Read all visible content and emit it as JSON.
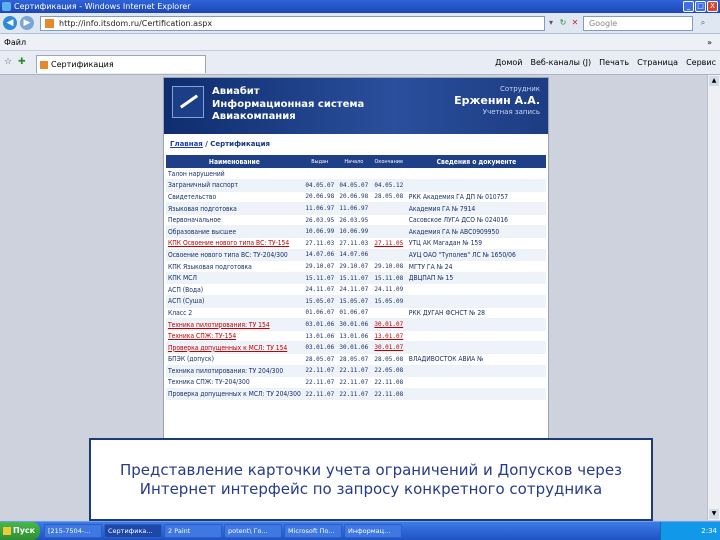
{
  "window": {
    "title": "Сертификация - Windows Internet Explorer",
    "buttons": [
      "_",
      "□",
      "X"
    ]
  },
  "address": {
    "url": "http://info.itsdom.ru/Certification.aspx",
    "search_placeholder": "Google"
  },
  "menu": {
    "file": "Файл",
    "help_glyph": "»"
  },
  "tab": {
    "title": "Сертификация"
  },
  "toolbar": {
    "home": "Домой",
    "feeds": "Веб-каналы (J)",
    "print": "Печать",
    "page": "Страница",
    "tools": "Сервис"
  },
  "site": {
    "brand_line1": "Авиабит",
    "brand_line2": "Информационная система",
    "brand_line3": "Авиакомпания",
    "user_role": "Сотрудник",
    "user_name": "Ерженин А.А.",
    "user_account": "Учетная запись"
  },
  "breadcrumb": {
    "home": "Главная",
    "separator": " / ",
    "current": "Сертификация"
  },
  "table": {
    "headers": [
      "Наименование",
      "Выдан",
      "Начало",
      "Окончание",
      "Сведения о документе"
    ],
    "rows": [
      {
        "name": "Талон нарушений",
        "issued": "",
        "start": "",
        "end": "",
        "info": ""
      },
      {
        "name": "Заграничный паспорт",
        "issued": "04.05.07",
        "start": "04.05.07",
        "end": "04.05.12",
        "info": ""
      },
      {
        "name": "Свидетельство",
        "issued": "20.06.98",
        "start": "20.06.98",
        "end": "28.05.08",
        "info": "РКК Академия ГА ДП № 010757"
      },
      {
        "name": "Языковая подготовка",
        "issued": "11.06.97",
        "start": "11.06.97",
        "end": "",
        "info": "Академия ГА № 7914"
      },
      {
        "name": "Первоначальное",
        "issued": "26.03.95",
        "start": "26.03.95",
        "end": "",
        "info": "Сасовское ЛУГА ДСО № 024016"
      },
      {
        "name": "Образование высшее",
        "issued": "10.06.99",
        "start": "10.06.99",
        "end": "",
        "info": "Академия ГА № АВС0909950"
      },
      {
        "name": "КПК Освоение нового типа ВС: ТУ-154",
        "issued": "27.11.03",
        "start": "27.11.03",
        "end": "27.11.05",
        "info": "УТЦ АК Магадан № 159",
        "warn": true
      },
      {
        "name": "Освоение нового типа ВС: ТУ-204/300",
        "issued": "14.07.06",
        "start": "14.07.06",
        "end": "",
        "info": "АУЦ ОАО \"Туполев\" ЛС № 1650/06"
      },
      {
        "name": "КПК Языковая подготовка",
        "issued": "29.10.07",
        "start": "29.10.07",
        "end": "29.10.08",
        "info": "МГТУ ГА № 24"
      },
      {
        "name": "КПК МСЛ",
        "issued": "15.11.07",
        "start": "15.11.07",
        "end": "15.11.08",
        "info": "ДВЦПАП № 15"
      },
      {
        "name": "АСП (Вода)",
        "issued": "24.11.07",
        "start": "24.11.07",
        "end": "24.11.09",
        "info": ""
      },
      {
        "name": "АСП (Суша)",
        "issued": "15.05.07",
        "start": "15.05.07",
        "end": "15.05.09",
        "info": ""
      },
      {
        "name": "Класс 2",
        "issued": "01.06.07",
        "start": "01.06.07",
        "end": "",
        "info": "РКК ДУГАН ФСНСТ № 28"
      },
      {
        "name": "Техника пилотирования: ТУ 154",
        "issued": "03.01.06",
        "start": "30.01.06",
        "end": "30.01.07",
        "info": "",
        "warn": true
      },
      {
        "name": "Техника СПЖ: ТУ-154",
        "issued": "13.01.06",
        "start": "13.01.06",
        "end": "13.01.07",
        "info": "",
        "warn": true
      },
      {
        "name": "Проверка допущенных к МСЛ: ТУ 154",
        "issued": "03.01.06",
        "start": "30.01.06",
        "end": "30.01.07",
        "info": "",
        "warn": true
      },
      {
        "name": "БПЭК (допуск)",
        "issued": "28.05.07",
        "start": "28.05.07",
        "end": "28.05.08",
        "info": "ВЛАДИВОСТОК АВИА №"
      },
      {
        "name": "Техника пилотирования: ТУ 204/300",
        "issued": "22.11.07",
        "start": "22.11.07",
        "end": "22.05.08",
        "info": ""
      },
      {
        "name": "Техника СПЖ: ТУ-204/300",
        "issued": "22.11.07",
        "start": "22.11.07",
        "end": "22.11.08",
        "info": ""
      },
      {
        "name": "Проверка допущенных к МСЛ: ТУ 204/300",
        "issued": "22.11.07",
        "start": "22.11.07",
        "end": "22.11.08",
        "info": ""
      }
    ]
  },
  "caption": "Представление карточки учета ограничений и Допусков через Интернет интерфейс по запросу конкретного сотрудника",
  "taskbar": {
    "start": "Пуск",
    "tasks": [
      "[215-7504-...",
      "Сертифика...",
      "2 Paint",
      "potent\\ Го...",
      "Microsoft По...",
      "Информац..."
    ],
    "clock": "2:34"
  }
}
